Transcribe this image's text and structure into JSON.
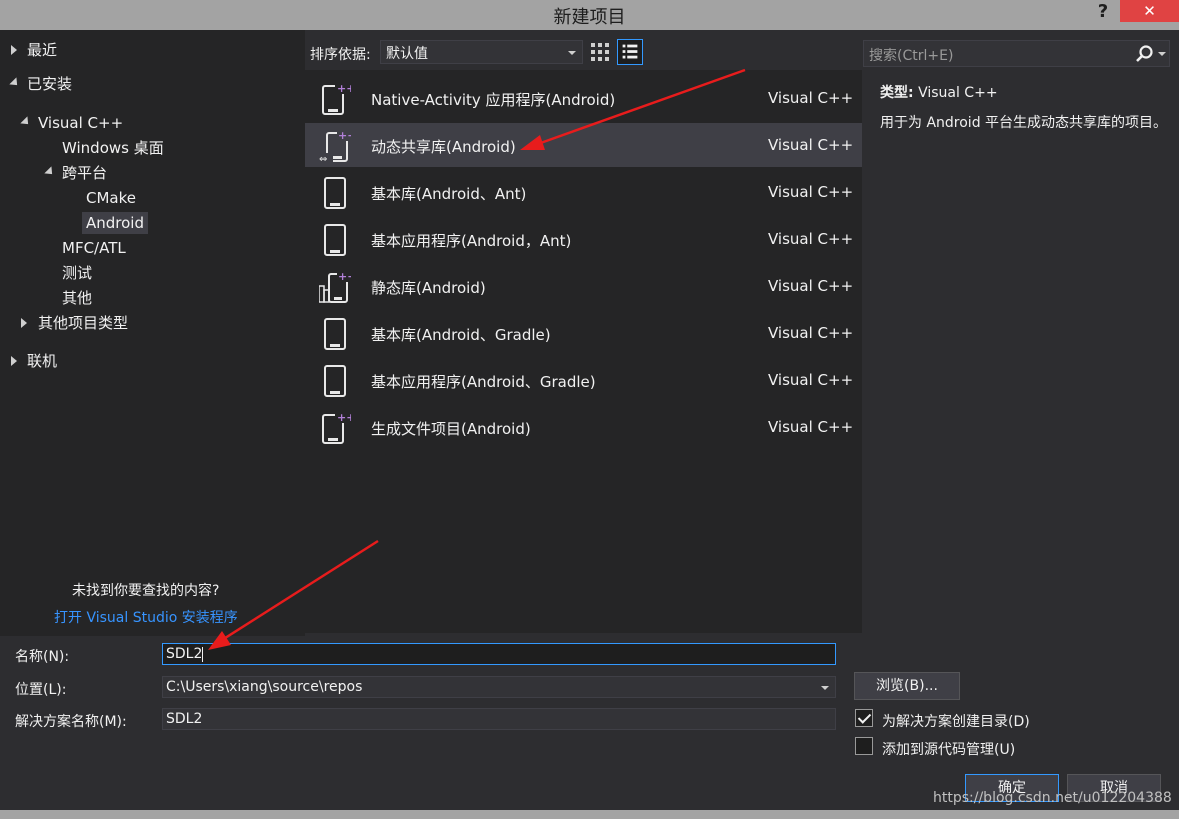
{
  "window": {
    "title": "新建项目",
    "help": "?",
    "close": "✕"
  },
  "tree": {
    "recent": "最近",
    "installed": "已安装",
    "visual_cpp": "Visual C++",
    "windows_desktop": "Windows 桌面",
    "cross_platform": "跨平台",
    "cmake": "CMake",
    "android": "Android",
    "mfc_atl": "MFC/ATL",
    "test": "测试",
    "other": "其他",
    "other_types": "其他项目类型",
    "online": "联机",
    "not_found": "未找到你要查找的内容?",
    "open_installer": "打开 Visual Studio 安装程序"
  },
  "sort": {
    "label": "排序依据:",
    "value": "默认值"
  },
  "templates": [
    {
      "name": "Native-Activity 应用程序(Android)",
      "lang": "Visual C++",
      "icon": "native-activity-icon"
    },
    {
      "name": "动态共享库(Android)",
      "lang": "Visual C++",
      "icon": "shared-library-icon"
    },
    {
      "name": "基本库(Android、Ant)",
      "lang": "Visual C++",
      "icon": "phone-icon"
    },
    {
      "name": "基本应用程序(Android，Ant)",
      "lang": "Visual C++",
      "icon": "phone-icon"
    },
    {
      "name": "静态库(Android)",
      "lang": "Visual C++",
      "icon": "static-library-icon"
    },
    {
      "name": "基本库(Android、Gradle)",
      "lang": "Visual C++",
      "icon": "phone-icon"
    },
    {
      "name": "基本应用程序(Android、Gradle)",
      "lang": "Visual C++",
      "icon": "phone-icon"
    },
    {
      "name": "生成文件项目(Android)",
      "lang": "Visual C++",
      "icon": "makefile-icon"
    }
  ],
  "search": {
    "placeholder": "搜索(Ctrl+E)"
  },
  "detail": {
    "type_label": "类型:",
    "type_value": "Visual C++",
    "description": "用于为 Android 平台生成动态共享库的项目。"
  },
  "form": {
    "name_label": "名称(N):",
    "name_value": "SDL2",
    "location_label": "位置(L):",
    "location_value": "C:\\Users\\xiang\\source\\repos",
    "solution_label": "解决方案名称(M):",
    "solution_value": "SDL2",
    "browse": "浏览(B)...",
    "create_dir": "为解决方案创建目录(D)",
    "add_scc": "添加到源代码管理(U)",
    "ok": "确定",
    "cancel": "取消"
  },
  "watermark": "https://blog.csdn.net/u012204388",
  "colors": {
    "accent": "#3399ff",
    "arrow": "#e81c1c",
    "icon_purple": "#b180d7"
  }
}
